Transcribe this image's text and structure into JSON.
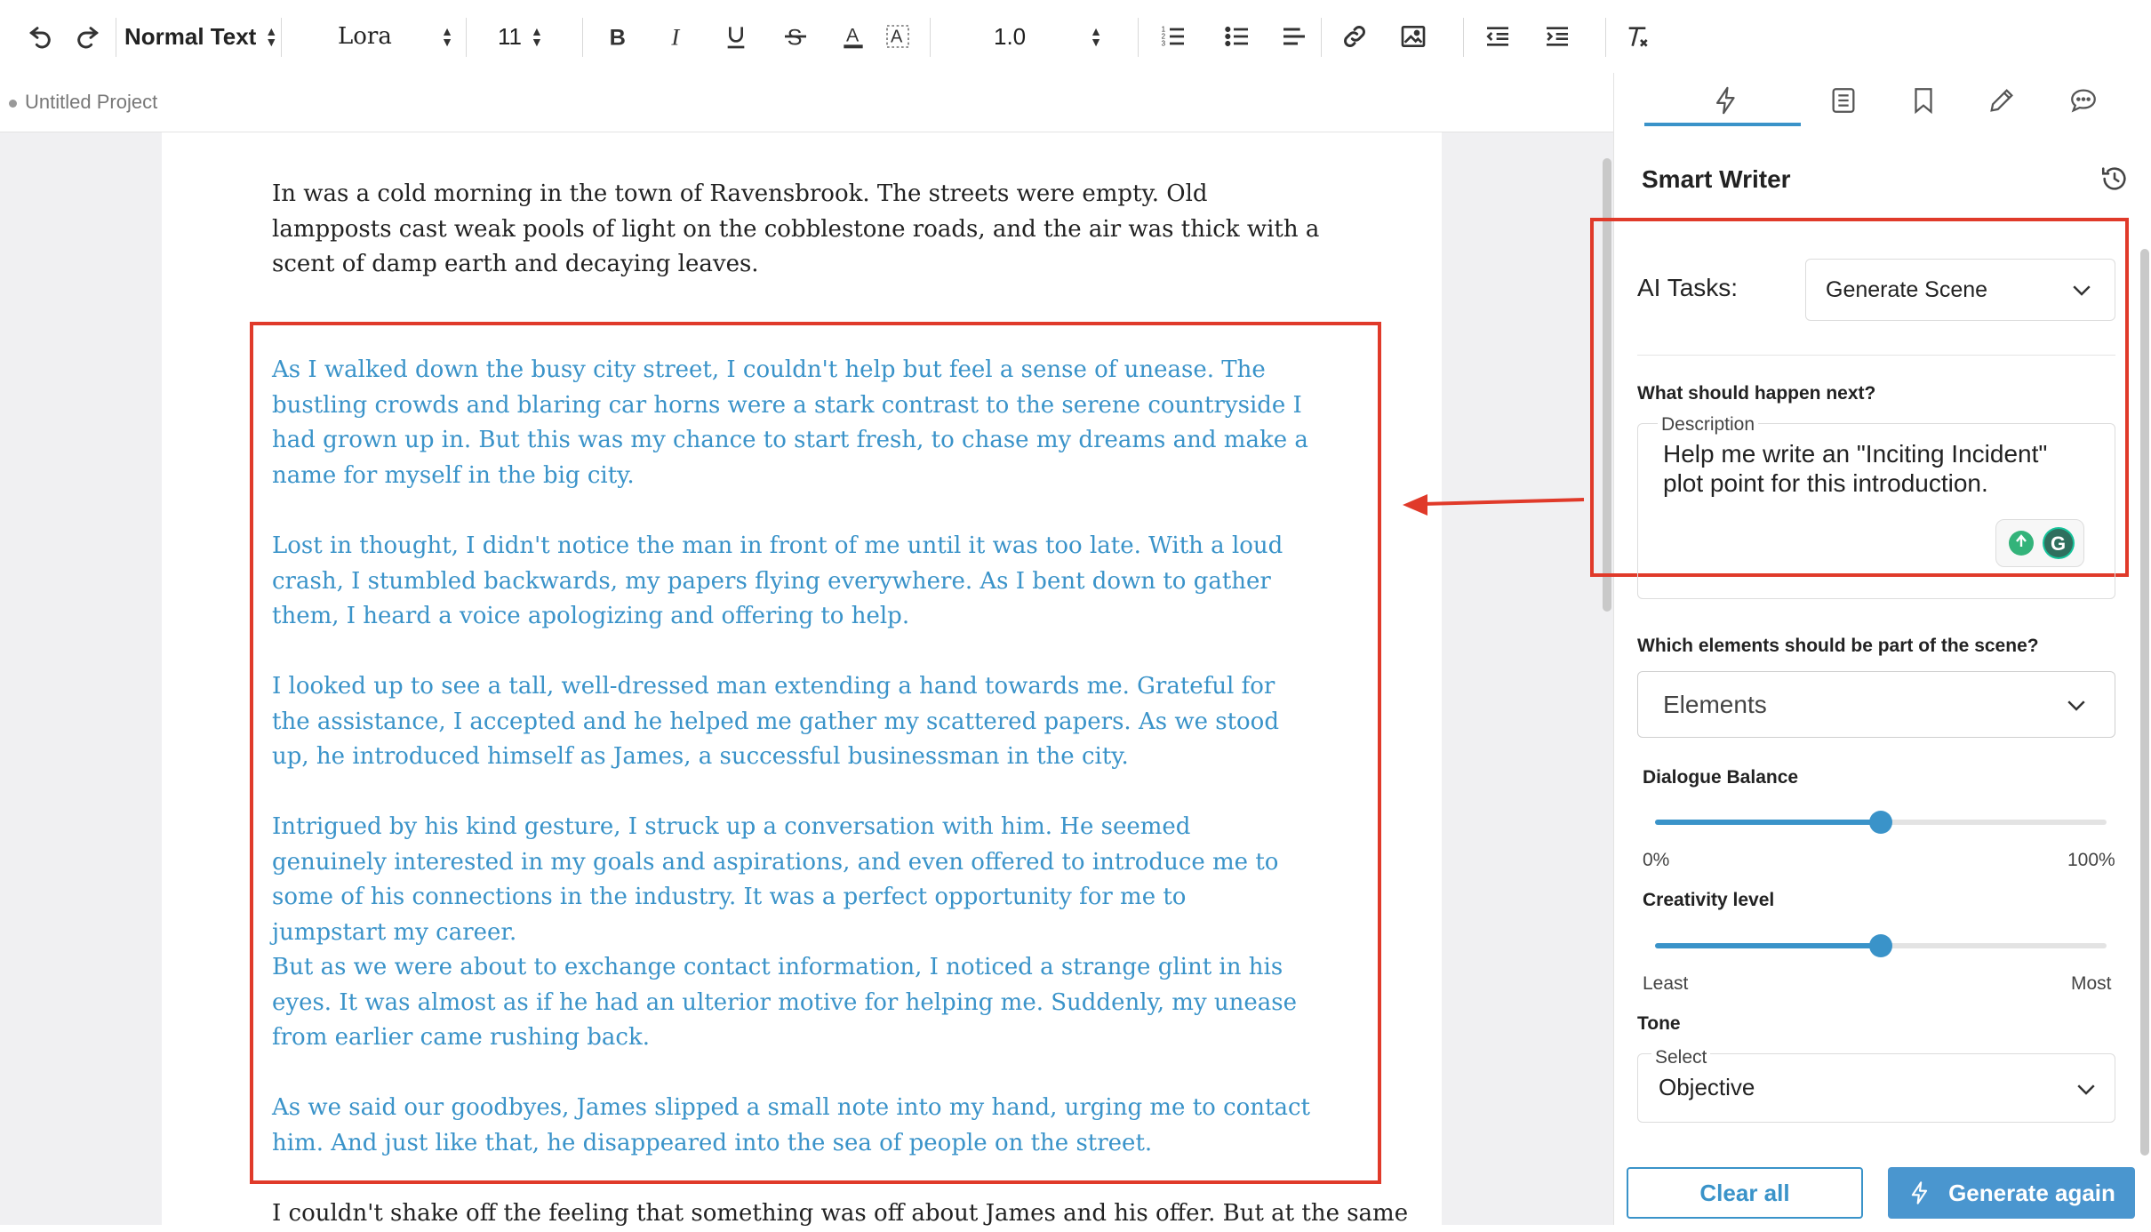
{
  "toolbar": {
    "undo": "undo-icon",
    "redo": "redo-icon",
    "style_select": "Normal Text",
    "font_select": "Lora",
    "size_select": "11",
    "line_spacing_select": "1.0",
    "buttons": [
      "bold",
      "italic",
      "underline",
      "strikethrough",
      "text-color",
      "highlight",
      "ordered-list",
      "bullet-list",
      "align",
      "link",
      "image",
      "outdent",
      "indent",
      "clear-format"
    ]
  },
  "project": {
    "name": "Untitled Project"
  },
  "document": {
    "intro": "In was a cold morning in the town of Ravensbrook. The streets were empty. Old lampposts cast weak pools of light on the cobblestone roads, and the air was thick with a scent of damp earth and decaying leaves.",
    "generated": [
      "As I walked down the busy city street, I couldn't help but feel a sense of unease. The bustling crowds and blaring car horns were a stark contrast to the serene countryside I had grown up in. But this was my chance to start fresh, to chase my dreams and make a name for myself in the big city.",
      "Lost in thought, I didn't notice the man in front of me until it was too late. With a loud crash, I stumbled backwards, my papers flying everywhere. As I bent down to gather them, I heard a voice apologizing and offering to help.",
      "I looked up to see a tall, well-dressed man extending a hand towards me. Grateful for the assistance, I accepted and he helped me gather my scattered papers. As we stood up, he introduced himself as James, a successful businessman in the city.",
      "Intrigued by his kind gesture, I struck up a conversation with him. He seemed genuinely interested in my goals and aspirations, and even offered to introduce me to some of his connections in the industry. It was a perfect opportunity for me to jumpstart my career.",
      "But as we were about to exchange contact information, I noticed a strange glint in his eyes. It was almost as if he had an ulterior motive for helping me. Suddenly, my unease from earlier came rushing back.",
      "As we said our goodbyes, James slipped a small note into my hand, urging me to contact him. And just like that, he disappeared into the sea of people on the street."
    ],
    "after": "I couldn't shake off the feeling that something was off about James and his offer. But at the same"
  },
  "panel": {
    "tabs": [
      "smart-writer",
      "outline",
      "bookmarks",
      "edit",
      "comments"
    ],
    "active_tab": "smart-writer",
    "title": "Smart Writer",
    "ai_tasks_label": "AI Tasks:",
    "ai_tasks_value": "Generate Scene",
    "next_question": "What should happen next?",
    "description_label": "Description",
    "description_text": "Help me write an \"Inciting Incident\" plot point for this introduction.",
    "elements_question": "Which elements should be part of the scene?",
    "elements_placeholder": "Elements",
    "dialogue_label": "Dialogue Balance",
    "dialogue_min": "0%",
    "dialogue_max": "100%",
    "dialogue_value": 0.5,
    "creativity_label": "Creativity level",
    "creativity_min": "Least",
    "creativity_max": "Most",
    "creativity_value": 0.5,
    "tone_label": "Tone",
    "tone_select_label": "Select",
    "tone_value": "Objective",
    "clear_button": "Clear all",
    "generate_button": "Generate again"
  },
  "colors": {
    "accent": "#3a93c9",
    "highlight_box": "#e03a2a",
    "generated_text": "#3a93c9"
  }
}
